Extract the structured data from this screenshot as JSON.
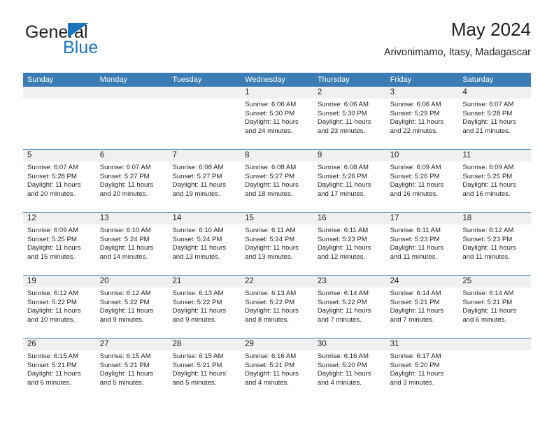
{
  "brand": {
    "name_top": "General",
    "name_bottom": "Blue",
    "accent_color": "#1b75bb"
  },
  "header": {
    "title": "May 2024",
    "subtitle": "Arivonimamo, Itasy, Madagascar",
    "header_bar_color": "#3b7cb5",
    "daynum_band_color": "#f0f0f0"
  },
  "weekday_headers": [
    "Sunday",
    "Monday",
    "Tuesday",
    "Wednesday",
    "Thursday",
    "Friday",
    "Saturday"
  ],
  "weeks": [
    [
      {
        "day": "",
        "empty": true
      },
      {
        "day": "",
        "empty": true
      },
      {
        "day": "",
        "empty": true
      },
      {
        "day": "1",
        "sunrise": "Sunrise: 6:06 AM",
        "sunset": "Sunset: 5:30 PM",
        "daylight_1": "Daylight: 11 hours",
        "daylight_2": "and 24 minutes."
      },
      {
        "day": "2",
        "sunrise": "Sunrise: 6:06 AM",
        "sunset": "Sunset: 5:30 PM",
        "daylight_1": "Daylight: 11 hours",
        "daylight_2": "and 23 minutes."
      },
      {
        "day": "3",
        "sunrise": "Sunrise: 6:06 AM",
        "sunset": "Sunset: 5:29 PM",
        "daylight_1": "Daylight: 11 hours",
        "daylight_2": "and 22 minutes."
      },
      {
        "day": "4",
        "sunrise": "Sunrise: 6:07 AM",
        "sunset": "Sunset: 5:28 PM",
        "daylight_1": "Daylight: 11 hours",
        "daylight_2": "and 21 minutes."
      }
    ],
    [
      {
        "day": "5",
        "sunrise": "Sunrise: 6:07 AM",
        "sunset": "Sunset: 5:28 PM",
        "daylight_1": "Daylight: 11 hours",
        "daylight_2": "and 20 minutes."
      },
      {
        "day": "6",
        "sunrise": "Sunrise: 6:07 AM",
        "sunset": "Sunset: 5:27 PM",
        "daylight_1": "Daylight: 11 hours",
        "daylight_2": "and 20 minutes."
      },
      {
        "day": "7",
        "sunrise": "Sunrise: 6:08 AM",
        "sunset": "Sunset: 5:27 PM",
        "daylight_1": "Daylight: 11 hours",
        "daylight_2": "and 19 minutes."
      },
      {
        "day": "8",
        "sunrise": "Sunrise: 6:08 AM",
        "sunset": "Sunset: 5:27 PM",
        "daylight_1": "Daylight: 11 hours",
        "daylight_2": "and 18 minutes."
      },
      {
        "day": "9",
        "sunrise": "Sunrise: 6:08 AM",
        "sunset": "Sunset: 5:26 PM",
        "daylight_1": "Daylight: 11 hours",
        "daylight_2": "and 17 minutes."
      },
      {
        "day": "10",
        "sunrise": "Sunrise: 6:09 AM",
        "sunset": "Sunset: 5:26 PM",
        "daylight_1": "Daylight: 11 hours",
        "daylight_2": "and 16 minutes."
      },
      {
        "day": "11",
        "sunrise": "Sunrise: 6:09 AM",
        "sunset": "Sunset: 5:25 PM",
        "daylight_1": "Daylight: 11 hours",
        "daylight_2": "and 16 minutes."
      }
    ],
    [
      {
        "day": "12",
        "sunrise": "Sunrise: 6:09 AM",
        "sunset": "Sunset: 5:25 PM",
        "daylight_1": "Daylight: 11 hours",
        "daylight_2": "and 15 minutes."
      },
      {
        "day": "13",
        "sunrise": "Sunrise: 6:10 AM",
        "sunset": "Sunset: 5:24 PM",
        "daylight_1": "Daylight: 11 hours",
        "daylight_2": "and 14 minutes."
      },
      {
        "day": "14",
        "sunrise": "Sunrise: 6:10 AM",
        "sunset": "Sunset: 5:24 PM",
        "daylight_1": "Daylight: 11 hours",
        "daylight_2": "and 13 minutes."
      },
      {
        "day": "15",
        "sunrise": "Sunrise: 6:11 AM",
        "sunset": "Sunset: 5:24 PM",
        "daylight_1": "Daylight: 11 hours",
        "daylight_2": "and 13 minutes."
      },
      {
        "day": "16",
        "sunrise": "Sunrise: 6:11 AM",
        "sunset": "Sunset: 5:23 PM",
        "daylight_1": "Daylight: 11 hours",
        "daylight_2": "and 12 minutes."
      },
      {
        "day": "17",
        "sunrise": "Sunrise: 6:11 AM",
        "sunset": "Sunset: 5:23 PM",
        "daylight_1": "Daylight: 11 hours",
        "daylight_2": "and 11 minutes."
      },
      {
        "day": "18",
        "sunrise": "Sunrise: 6:12 AM",
        "sunset": "Sunset: 5:23 PM",
        "daylight_1": "Daylight: 11 hours",
        "daylight_2": "and 11 minutes."
      }
    ],
    [
      {
        "day": "19",
        "sunrise": "Sunrise: 6:12 AM",
        "sunset": "Sunset: 5:22 PM",
        "daylight_1": "Daylight: 11 hours",
        "daylight_2": "and 10 minutes."
      },
      {
        "day": "20",
        "sunrise": "Sunrise: 6:12 AM",
        "sunset": "Sunset: 5:22 PM",
        "daylight_1": "Daylight: 11 hours",
        "daylight_2": "and 9 minutes."
      },
      {
        "day": "21",
        "sunrise": "Sunrise: 6:13 AM",
        "sunset": "Sunset: 5:22 PM",
        "daylight_1": "Daylight: 11 hours",
        "daylight_2": "and 9 minutes."
      },
      {
        "day": "22",
        "sunrise": "Sunrise: 6:13 AM",
        "sunset": "Sunset: 5:22 PM",
        "daylight_1": "Daylight: 11 hours",
        "daylight_2": "and 8 minutes."
      },
      {
        "day": "23",
        "sunrise": "Sunrise: 6:14 AM",
        "sunset": "Sunset: 5:22 PM",
        "daylight_1": "Daylight: 11 hours",
        "daylight_2": "and 7 minutes."
      },
      {
        "day": "24",
        "sunrise": "Sunrise: 6:14 AM",
        "sunset": "Sunset: 5:21 PM",
        "daylight_1": "Daylight: 11 hours",
        "daylight_2": "and 7 minutes."
      },
      {
        "day": "25",
        "sunrise": "Sunrise: 6:14 AM",
        "sunset": "Sunset: 5:21 PM",
        "daylight_1": "Daylight: 11 hours",
        "daylight_2": "and 6 minutes."
      }
    ],
    [
      {
        "day": "26",
        "sunrise": "Sunrise: 6:15 AM",
        "sunset": "Sunset: 5:21 PM",
        "daylight_1": "Daylight: 11 hours",
        "daylight_2": "and 6 minutes."
      },
      {
        "day": "27",
        "sunrise": "Sunrise: 6:15 AM",
        "sunset": "Sunset: 5:21 PM",
        "daylight_1": "Daylight: 11 hours",
        "daylight_2": "and 5 minutes."
      },
      {
        "day": "28",
        "sunrise": "Sunrise: 6:15 AM",
        "sunset": "Sunset: 5:21 PM",
        "daylight_1": "Daylight: 11 hours",
        "daylight_2": "and 5 minutes."
      },
      {
        "day": "29",
        "sunrise": "Sunrise: 6:16 AM",
        "sunset": "Sunset: 5:21 PM",
        "daylight_1": "Daylight: 11 hours",
        "daylight_2": "and 4 minutes."
      },
      {
        "day": "30",
        "sunrise": "Sunrise: 6:16 AM",
        "sunset": "Sunset: 5:20 PM",
        "daylight_1": "Daylight: 11 hours",
        "daylight_2": "and 4 minutes."
      },
      {
        "day": "31",
        "sunrise": "Sunrise: 6:17 AM",
        "sunset": "Sunset: 5:20 PM",
        "daylight_1": "Daylight: 11 hours",
        "daylight_2": "and 3 minutes."
      },
      {
        "day": "",
        "empty": true
      }
    ]
  ]
}
